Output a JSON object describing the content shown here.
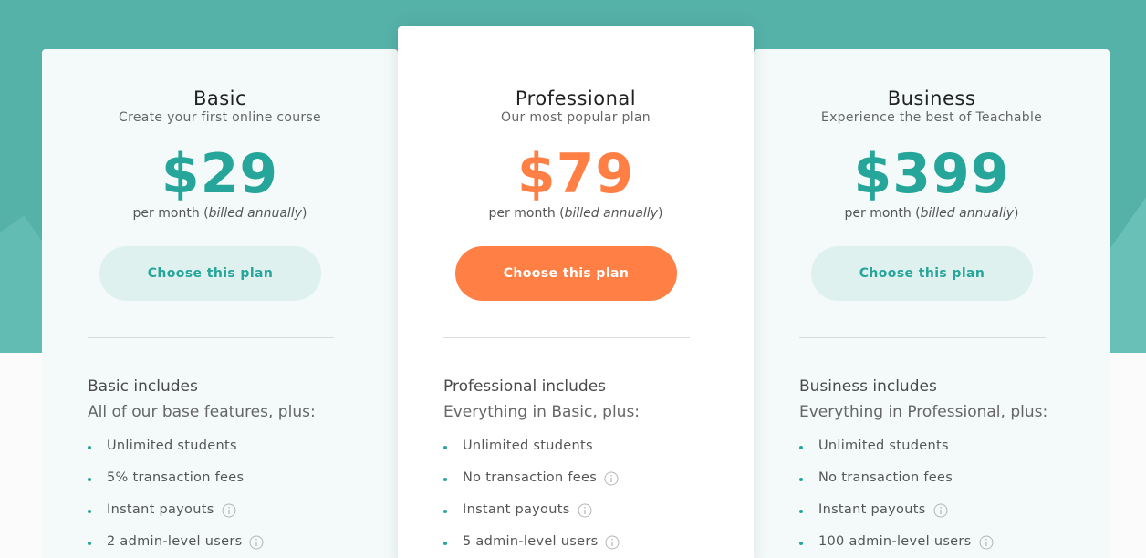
{
  "plans": [
    {
      "name": "Basic",
      "tagline": "Create your first online course",
      "price": "$29",
      "billing_prefix": "per month (",
      "billing_italic": "billed annually",
      "billing_suffix": ")",
      "cta_label": "Choose this plan",
      "includes_title": "Basic includes",
      "includes_sub": "All of our base features, plus:",
      "features": [
        {
          "label": "Unlimited students",
          "info": false
        },
        {
          "label": "5% transaction fees",
          "info": false
        },
        {
          "label": "Instant payouts",
          "info": true
        },
        {
          "label": "2 admin-level users",
          "info": true
        }
      ]
    },
    {
      "name": "Professional",
      "tagline": "Our most popular plan",
      "price": "$79",
      "billing_prefix": "per month (",
      "billing_italic": "billed annually",
      "billing_suffix": ")",
      "cta_label": "Choose this plan",
      "includes_title": "Professional includes",
      "includes_sub": "Everything in Basic, plus:",
      "features": [
        {
          "label": "Unlimited students",
          "info": false
        },
        {
          "label": "No transaction fees",
          "info": true
        },
        {
          "label": "Instant payouts",
          "info": true
        },
        {
          "label": "5 admin-level users",
          "info": true
        }
      ]
    },
    {
      "name": "Business",
      "tagline": "Experience the best of Teachable",
      "price": "$399",
      "billing_prefix": "per month (",
      "billing_italic": "billed annually",
      "billing_suffix": ")",
      "cta_label": "Choose this plan",
      "includes_title": "Business includes",
      "includes_sub": "Everything in Professional, plus:",
      "features": [
        {
          "label": "Unlimited students",
          "info": false
        },
        {
          "label": "No transaction fees",
          "info": false
        },
        {
          "label": "Instant payouts",
          "info": true
        },
        {
          "label": "100 admin-level users",
          "info": true
        }
      ]
    }
  ],
  "colors": {
    "teal": "#26a59a",
    "orange": "#ff7f45",
    "hero_bg": "#55b2a9"
  },
  "icons": {
    "feature_bullet": "bullet-dot-icon",
    "feature_info": "info-icon"
  }
}
